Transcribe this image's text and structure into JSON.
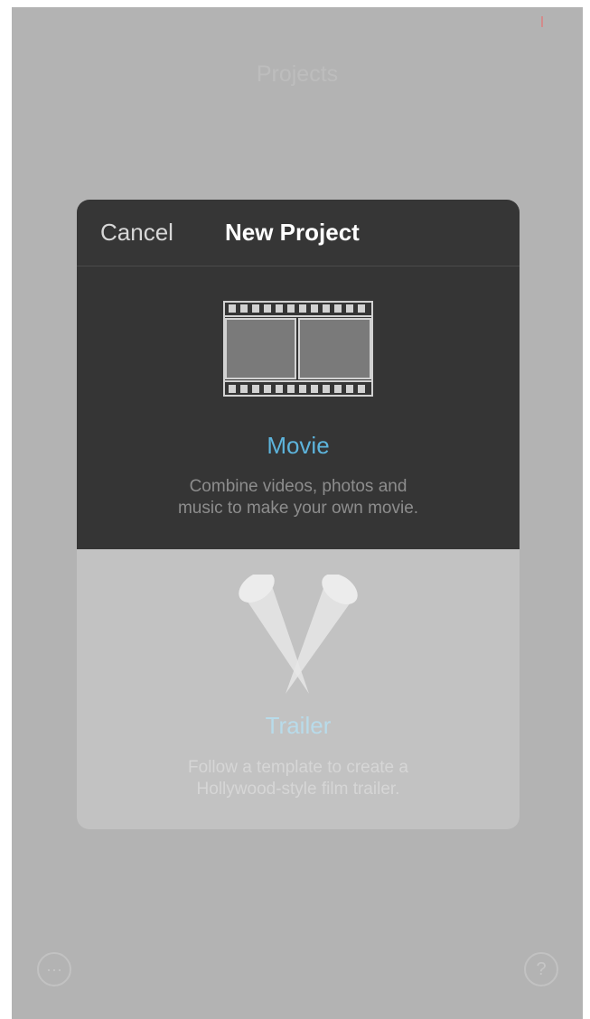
{
  "background": {
    "page_title": "Projects",
    "more_button_icon": "ellipsis-icon",
    "more_button_glyph": "···",
    "help_button_icon": "question-icon",
    "help_button_glyph": "?"
  },
  "modal": {
    "cancel_label": "Cancel",
    "title": "New Project",
    "options": [
      {
        "icon": "film-strip-icon",
        "label": "Movie",
        "description_line1": "Combine videos, photos and",
        "description_line2": "music to make your own movie."
      },
      {
        "icon": "spotlights-icon",
        "label": "Trailer",
        "description_line1": "Follow a template to create a",
        "description_line2": "Hollywood-style film trailer."
      }
    ]
  },
  "colors": {
    "accent_blue": "#5db4dc",
    "modal_dark": "#353535",
    "dimmed_backdrop": "#b3b3b3"
  }
}
